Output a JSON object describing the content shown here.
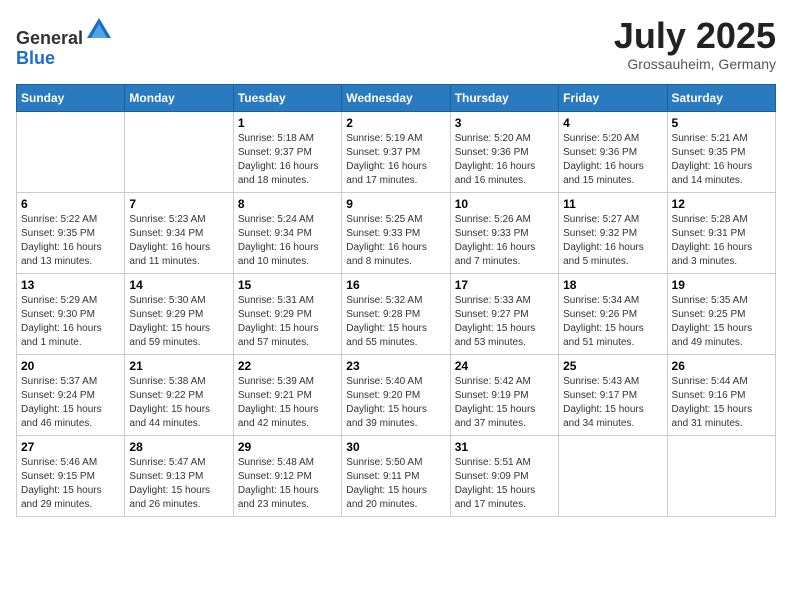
{
  "header": {
    "logo_line1": "General",
    "logo_line2": "Blue",
    "month_title": "July 2025",
    "location": "Grossauheim, Germany"
  },
  "days_of_week": [
    "Sunday",
    "Monday",
    "Tuesday",
    "Wednesday",
    "Thursday",
    "Friday",
    "Saturday"
  ],
  "weeks": [
    [
      {
        "day": "",
        "content": ""
      },
      {
        "day": "",
        "content": ""
      },
      {
        "day": "1",
        "content": "Sunrise: 5:18 AM\nSunset: 9:37 PM\nDaylight: 16 hours and 18 minutes."
      },
      {
        "day": "2",
        "content": "Sunrise: 5:19 AM\nSunset: 9:37 PM\nDaylight: 16 hours and 17 minutes."
      },
      {
        "day": "3",
        "content": "Sunrise: 5:20 AM\nSunset: 9:36 PM\nDaylight: 16 hours and 16 minutes."
      },
      {
        "day": "4",
        "content": "Sunrise: 5:20 AM\nSunset: 9:36 PM\nDaylight: 16 hours and 15 minutes."
      },
      {
        "day": "5",
        "content": "Sunrise: 5:21 AM\nSunset: 9:35 PM\nDaylight: 16 hours and 14 minutes."
      }
    ],
    [
      {
        "day": "6",
        "content": "Sunrise: 5:22 AM\nSunset: 9:35 PM\nDaylight: 16 hours and 13 minutes."
      },
      {
        "day": "7",
        "content": "Sunrise: 5:23 AM\nSunset: 9:34 PM\nDaylight: 16 hours and 11 minutes."
      },
      {
        "day": "8",
        "content": "Sunrise: 5:24 AM\nSunset: 9:34 PM\nDaylight: 16 hours and 10 minutes."
      },
      {
        "day": "9",
        "content": "Sunrise: 5:25 AM\nSunset: 9:33 PM\nDaylight: 16 hours and 8 minutes."
      },
      {
        "day": "10",
        "content": "Sunrise: 5:26 AM\nSunset: 9:33 PM\nDaylight: 16 hours and 7 minutes."
      },
      {
        "day": "11",
        "content": "Sunrise: 5:27 AM\nSunset: 9:32 PM\nDaylight: 16 hours and 5 minutes."
      },
      {
        "day": "12",
        "content": "Sunrise: 5:28 AM\nSunset: 9:31 PM\nDaylight: 16 hours and 3 minutes."
      }
    ],
    [
      {
        "day": "13",
        "content": "Sunrise: 5:29 AM\nSunset: 9:30 PM\nDaylight: 16 hours and 1 minute."
      },
      {
        "day": "14",
        "content": "Sunrise: 5:30 AM\nSunset: 9:29 PM\nDaylight: 15 hours and 59 minutes."
      },
      {
        "day": "15",
        "content": "Sunrise: 5:31 AM\nSunset: 9:29 PM\nDaylight: 15 hours and 57 minutes."
      },
      {
        "day": "16",
        "content": "Sunrise: 5:32 AM\nSunset: 9:28 PM\nDaylight: 15 hours and 55 minutes."
      },
      {
        "day": "17",
        "content": "Sunrise: 5:33 AM\nSunset: 9:27 PM\nDaylight: 15 hours and 53 minutes."
      },
      {
        "day": "18",
        "content": "Sunrise: 5:34 AM\nSunset: 9:26 PM\nDaylight: 15 hours and 51 minutes."
      },
      {
        "day": "19",
        "content": "Sunrise: 5:35 AM\nSunset: 9:25 PM\nDaylight: 15 hours and 49 minutes."
      }
    ],
    [
      {
        "day": "20",
        "content": "Sunrise: 5:37 AM\nSunset: 9:24 PM\nDaylight: 15 hours and 46 minutes."
      },
      {
        "day": "21",
        "content": "Sunrise: 5:38 AM\nSunset: 9:22 PM\nDaylight: 15 hours and 44 minutes."
      },
      {
        "day": "22",
        "content": "Sunrise: 5:39 AM\nSunset: 9:21 PM\nDaylight: 15 hours and 42 minutes."
      },
      {
        "day": "23",
        "content": "Sunrise: 5:40 AM\nSunset: 9:20 PM\nDaylight: 15 hours and 39 minutes."
      },
      {
        "day": "24",
        "content": "Sunrise: 5:42 AM\nSunset: 9:19 PM\nDaylight: 15 hours and 37 minutes."
      },
      {
        "day": "25",
        "content": "Sunrise: 5:43 AM\nSunset: 9:17 PM\nDaylight: 15 hours and 34 minutes."
      },
      {
        "day": "26",
        "content": "Sunrise: 5:44 AM\nSunset: 9:16 PM\nDaylight: 15 hours and 31 minutes."
      }
    ],
    [
      {
        "day": "27",
        "content": "Sunrise: 5:46 AM\nSunset: 9:15 PM\nDaylight: 15 hours and 29 minutes."
      },
      {
        "day": "28",
        "content": "Sunrise: 5:47 AM\nSunset: 9:13 PM\nDaylight: 15 hours and 26 minutes."
      },
      {
        "day": "29",
        "content": "Sunrise: 5:48 AM\nSunset: 9:12 PM\nDaylight: 15 hours and 23 minutes."
      },
      {
        "day": "30",
        "content": "Sunrise: 5:50 AM\nSunset: 9:11 PM\nDaylight: 15 hours and 20 minutes."
      },
      {
        "day": "31",
        "content": "Sunrise: 5:51 AM\nSunset: 9:09 PM\nDaylight: 15 hours and 17 minutes."
      },
      {
        "day": "",
        "content": ""
      },
      {
        "day": "",
        "content": ""
      }
    ]
  ]
}
